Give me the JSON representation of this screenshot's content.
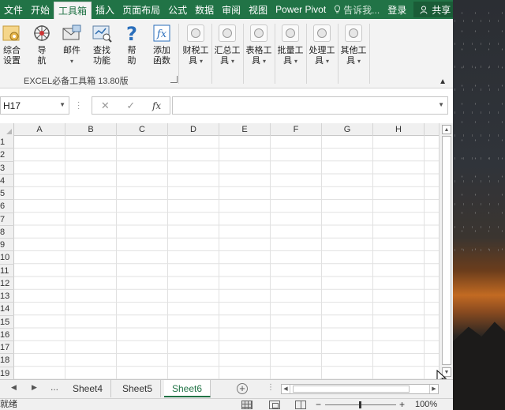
{
  "ribbon_tabs": [
    "文件",
    "开始",
    "工具箱",
    "插入",
    "页面布局",
    "公式",
    "数据",
    "审阅",
    "视图",
    "Power Pivot"
  ],
  "tell_me": "告诉我...",
  "login": "登录",
  "share": "共享",
  "ribbon_buttons": [
    {
      "line1": "综合",
      "line2": "设置",
      "icon": "settings-icon"
    },
    {
      "line1": "导",
      "line2": "航",
      "icon": "compass-icon"
    },
    {
      "line1": "邮件",
      "line2": "▾",
      "icon": "mail-icon"
    },
    {
      "line1": "查找",
      "line2": "功能",
      "icon": "find-icon"
    },
    {
      "line1": "帮",
      "line2": "助",
      "icon": "help-icon"
    },
    {
      "line1": "添加",
      "line2": "函数",
      "icon": "function-icon"
    }
  ],
  "ribbon_menus": [
    {
      "line1": "财税工",
      "line2": "具"
    },
    {
      "line1": "汇总工",
      "line2": "具"
    },
    {
      "line1": "表格工",
      "line2": "具"
    },
    {
      "line1": "批量工",
      "line2": "具"
    },
    {
      "line1": "处理工",
      "line2": "具"
    },
    {
      "line1": "其他工",
      "line2": "具"
    }
  ],
  "group_label": "EXCEL必备工具箱 13.80版",
  "name_box": "H17",
  "fx_label": "fx",
  "columns": [
    "A",
    "B",
    "C",
    "D",
    "E",
    "F",
    "G",
    "H"
  ],
  "rows": [
    "1",
    "2",
    "3",
    "4",
    "5",
    "6",
    "7",
    "8",
    "9",
    "10",
    "11",
    "12",
    "13",
    "14",
    "15",
    "16",
    "17",
    "18",
    "19"
  ],
  "sheet_nav": [
    "◀",
    "▶",
    "..."
  ],
  "sheets": [
    "Sheet4",
    "Sheet5",
    "Sheet6"
  ],
  "active_sheet": "Sheet6",
  "status": "就绪",
  "zoom": "100%",
  "colors": {
    "accent": "#217346",
    "ribbon_bg": "#f3f3f3"
  }
}
